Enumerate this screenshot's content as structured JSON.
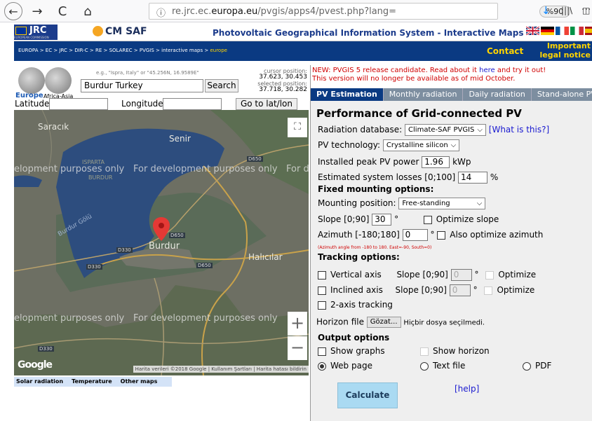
{
  "browser": {
    "back": "←",
    "forward": "→",
    "reload": "C",
    "home": "⌂",
    "url_prefix": "re.jrc.ec.",
    "url_domain": "europa.eu",
    "url_path": "/pvgis/apps4/pvest.php?lang=",
    "zoom": "%90",
    "more": "···",
    "bookmark": "☆",
    "pocket": "⊽",
    "download": "↓",
    "library": "|||\\"
  },
  "header": {
    "jrc": "JRC",
    "jrc_sub": "EUROPEAN COMMISSION",
    "cmsaf": "CM SAF",
    "title": "Photovoltaic Geographical Information System - Interactive Maps",
    "breadcrumb": "EUROPA > EC > JRC > DIR-C > RE > SOLAREC > PVGIS > interactive maps > ",
    "breadcrumb_current": "europe",
    "contact": "Contact",
    "legal": "Important legal notice"
  },
  "search": {
    "europe": "Europe",
    "africa_asia": "Africa-Asia",
    "hint": "e.g., \"Ispra, Italy\" or \"45.256N, 16.9589E\"",
    "value": "Burdur Turkey",
    "button": "Search",
    "cursor_label": "cursor position:",
    "cursor_value": "37.623, 30.453",
    "selected_label": "selected position:",
    "selected_value": "37.718, 30.282",
    "latitude_label": "Latitude:",
    "longitude_label": "Longitude:",
    "goto": "Go to lat/lon"
  },
  "map": {
    "labels": {
      "saracik": "Saracık",
      "senir": "Senir",
      "isparta": "ISPARTA",
      "burdur_region": "BURDUR",
      "burdur_golu": "Burdur Gölü",
      "burdur": "Burdur",
      "halicilar": "Halıcılar",
      "isparta_v": "ISPARTA\nBURDUR"
    },
    "dev": "For development purposes only",
    "dev_left": "elopment purposes only",
    "dev_right": "For d",
    "roads": {
      "d650a": "D650",
      "d650b": "D650",
      "d650c": "D650",
      "d330a": "D330",
      "d330b": "D330",
      "d330c": "D330"
    },
    "google": "Google",
    "attribution": "Harita verileri ©2018 Google | Kullanım Şartları | Harita hatası bildirin",
    "zoom_in": "+",
    "zoom_out": "−",
    "fullscreen": "⛶",
    "tabs": [
      "Solar radiation",
      "Temperature",
      "Other maps"
    ]
  },
  "notice": {
    "line1_pre": "NEW: PVGIS 5 release candidate. Read about it ",
    "line1_link": "here",
    "line1_post": " and try it out!",
    "line2": "This version will no longer be available as of mid October."
  },
  "tabs": [
    "PV Estimation",
    "Monthly radiation",
    "Daily radiation",
    "Stand-alone PV"
  ],
  "form": {
    "title": "Performance of Grid-connected PV",
    "radiation_label": "Radiation database:",
    "radiation_value": "Climate-SAF PVGIS",
    "what_is_this": "[What is this?]",
    "pv_tech_label": "PV technology:",
    "pv_tech_value": "Crystalline silicon",
    "peak_label": "Installed peak PV power",
    "peak_value": "1.96",
    "peak_unit": "kWp",
    "losses_label": "Estimated system losses [0;100]",
    "losses_value": "14",
    "losses_unit": "%",
    "fixed_heading": "Fixed mounting options:",
    "mounting_label": "Mounting position:",
    "mounting_value": "Free-standing",
    "slope_label": "Slope [0;90]",
    "slope_value": "30",
    "deg": "°",
    "optimize_slope": "Optimize slope",
    "azimuth_label": "Azimuth [-180;180]",
    "azimuth_value": "0",
    "also_optimize_azimuth": "Also optimize azimuth",
    "azimuth_note": "(Azimuth angle from -180 to 180. East=-90, South=0)",
    "tracking_heading": "Tracking options:",
    "vertical_axis": "Vertical axis",
    "inclined_axis": "Inclined axis",
    "track_slope_label": "Slope [0;90]",
    "track_slope_value": "0",
    "optimize": "Optimize",
    "two_axis": "2-axis tracking",
    "horizon_label": "Horizon file",
    "browse": "Gözat...",
    "no_file": "Hiçbir dosya seçilmedi.",
    "output_heading": "Output options",
    "show_graphs": "Show graphs",
    "show_horizon": "Show horizon",
    "web_page": "Web page",
    "text_file": "Text file",
    "pdf": "PDF",
    "help": "[help]",
    "calculate": "Calculate"
  }
}
